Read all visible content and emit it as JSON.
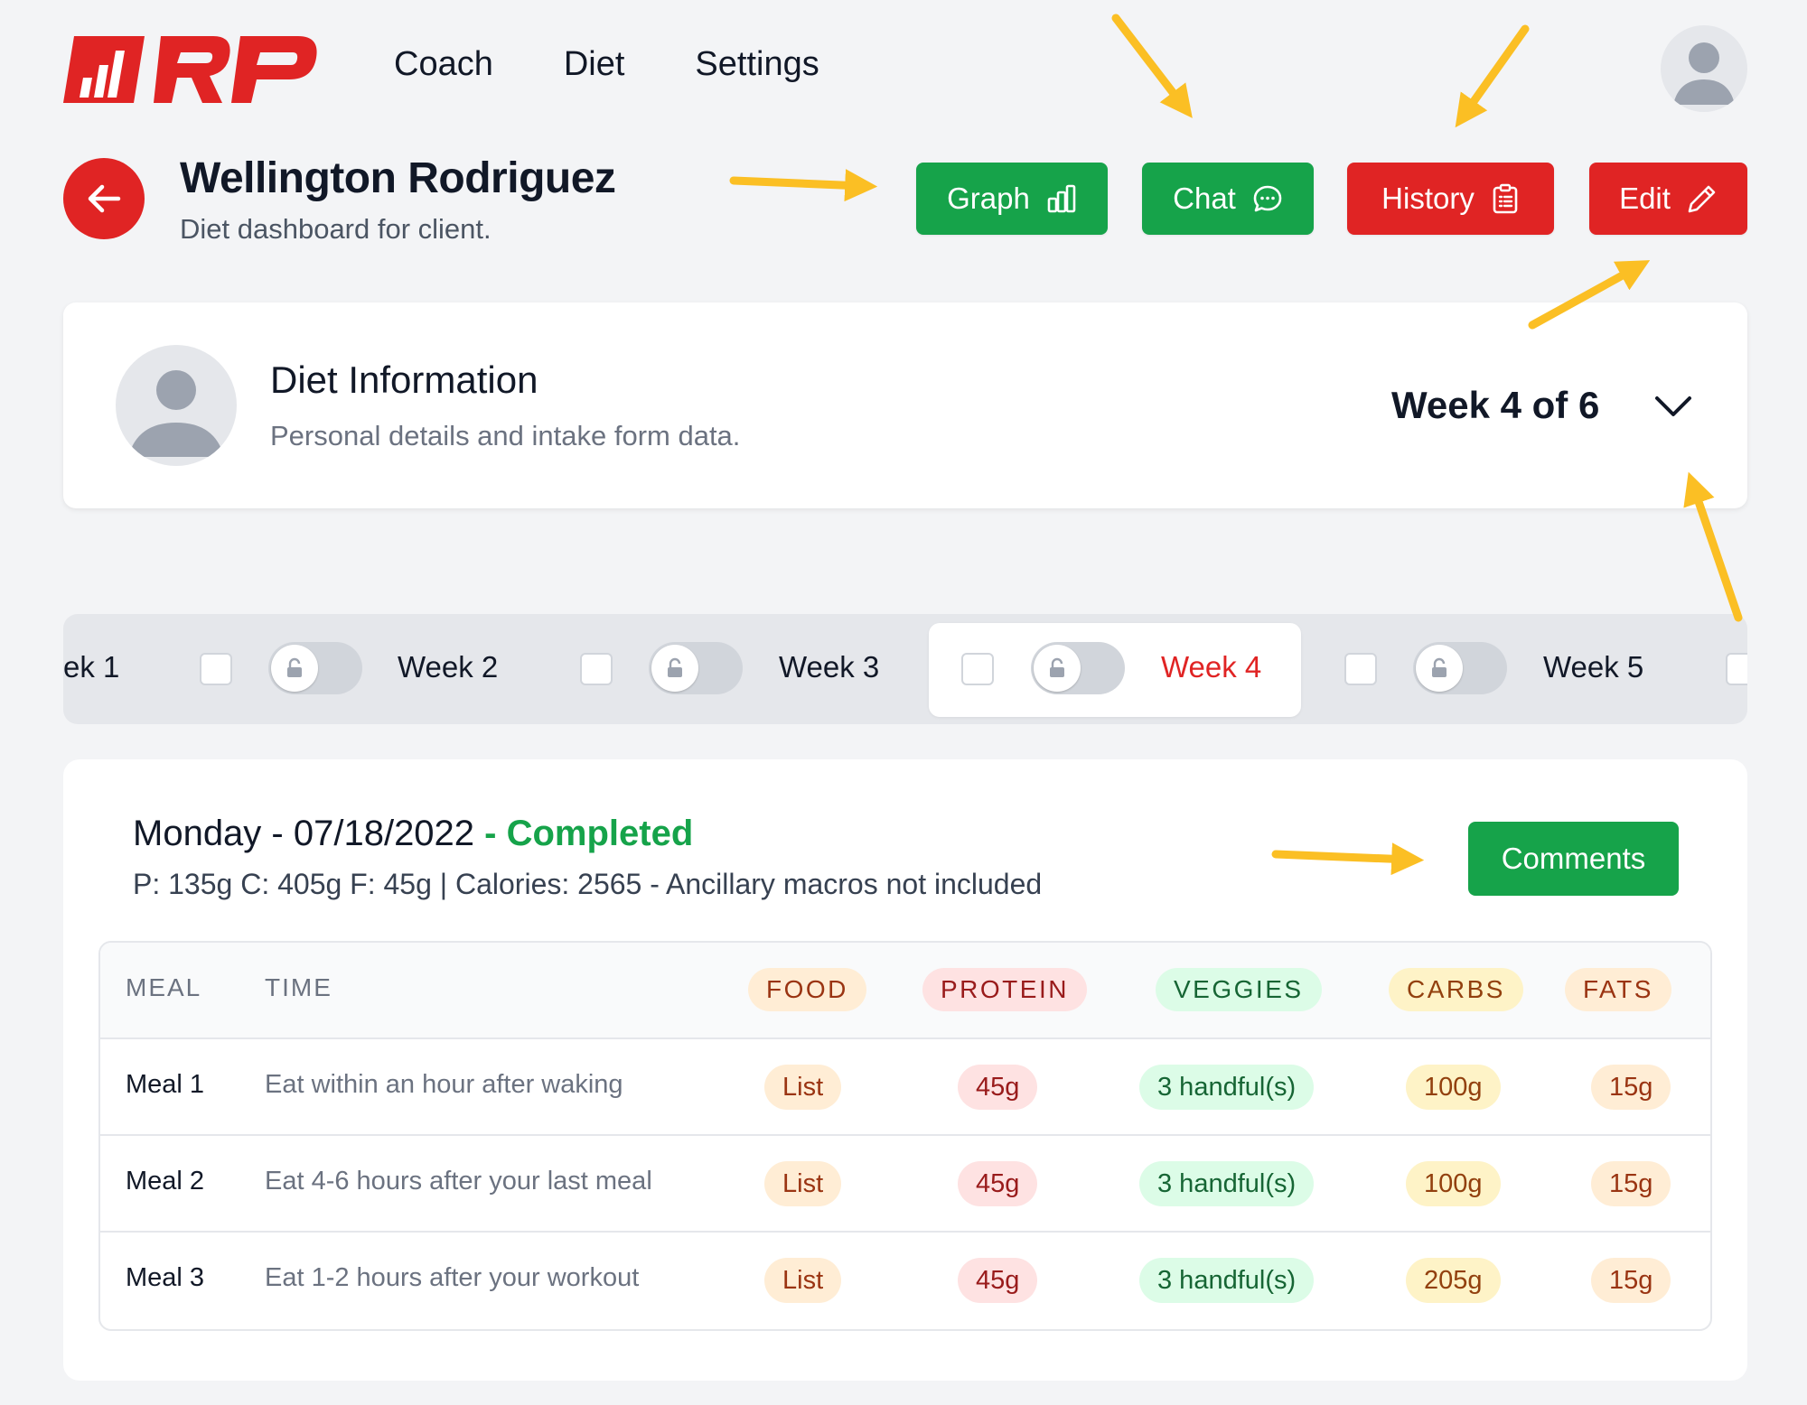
{
  "brand": {
    "logo_text": "RP",
    "accent": "#e02424",
    "green": "#16a34a"
  },
  "nav": {
    "items": [
      "Coach",
      "Diet",
      "Settings"
    ]
  },
  "header": {
    "client_name": "Wellington Rodriguez",
    "subtitle": "Diet dashboard for client.",
    "buttons": {
      "graph": "Graph",
      "chat": "Chat",
      "history": "History",
      "edit": "Edit"
    }
  },
  "diet_info": {
    "title": "Diet Information",
    "subtitle": "Personal details and intake form data.",
    "week_selector": "Week 4 of 6"
  },
  "weeks": [
    {
      "label": "ek 1"
    },
    {
      "label": "Week 2"
    },
    {
      "label": "Week 3"
    },
    {
      "label": "Week 4",
      "active": true
    },
    {
      "label": "Week 5"
    }
  ],
  "day": {
    "title": "Monday - 07/18/2022",
    "status": " - Completed",
    "macros": "P: 135g C: 405g F: 45g | Calories: 2565 - Ancillary macros not included",
    "comments_label": "Comments"
  },
  "table": {
    "headers": {
      "meal": "MEAL",
      "time": "TIME",
      "food": "FOOD",
      "protein": "PROTEIN",
      "veggies": "VEGGIES",
      "carbs": "CARBS",
      "fats": "FATS"
    },
    "rows": [
      {
        "meal": "Meal 1",
        "time": "Eat within an hour after waking",
        "food": "List",
        "protein": "45g",
        "veggies": "3 handful(s)",
        "carbs": "100g",
        "fats": "15g"
      },
      {
        "meal": "Meal 2",
        "time": "Eat 4-6 hours after your last meal",
        "food": "List",
        "protein": "45g",
        "veggies": "3 handful(s)",
        "carbs": "100g",
        "fats": "15g"
      },
      {
        "meal": "Meal 3",
        "time": "Eat 1-2 hours after your workout",
        "food": "List",
        "protein": "45g",
        "veggies": "3 handful(s)",
        "carbs": "205g",
        "fats": "15g"
      }
    ]
  }
}
